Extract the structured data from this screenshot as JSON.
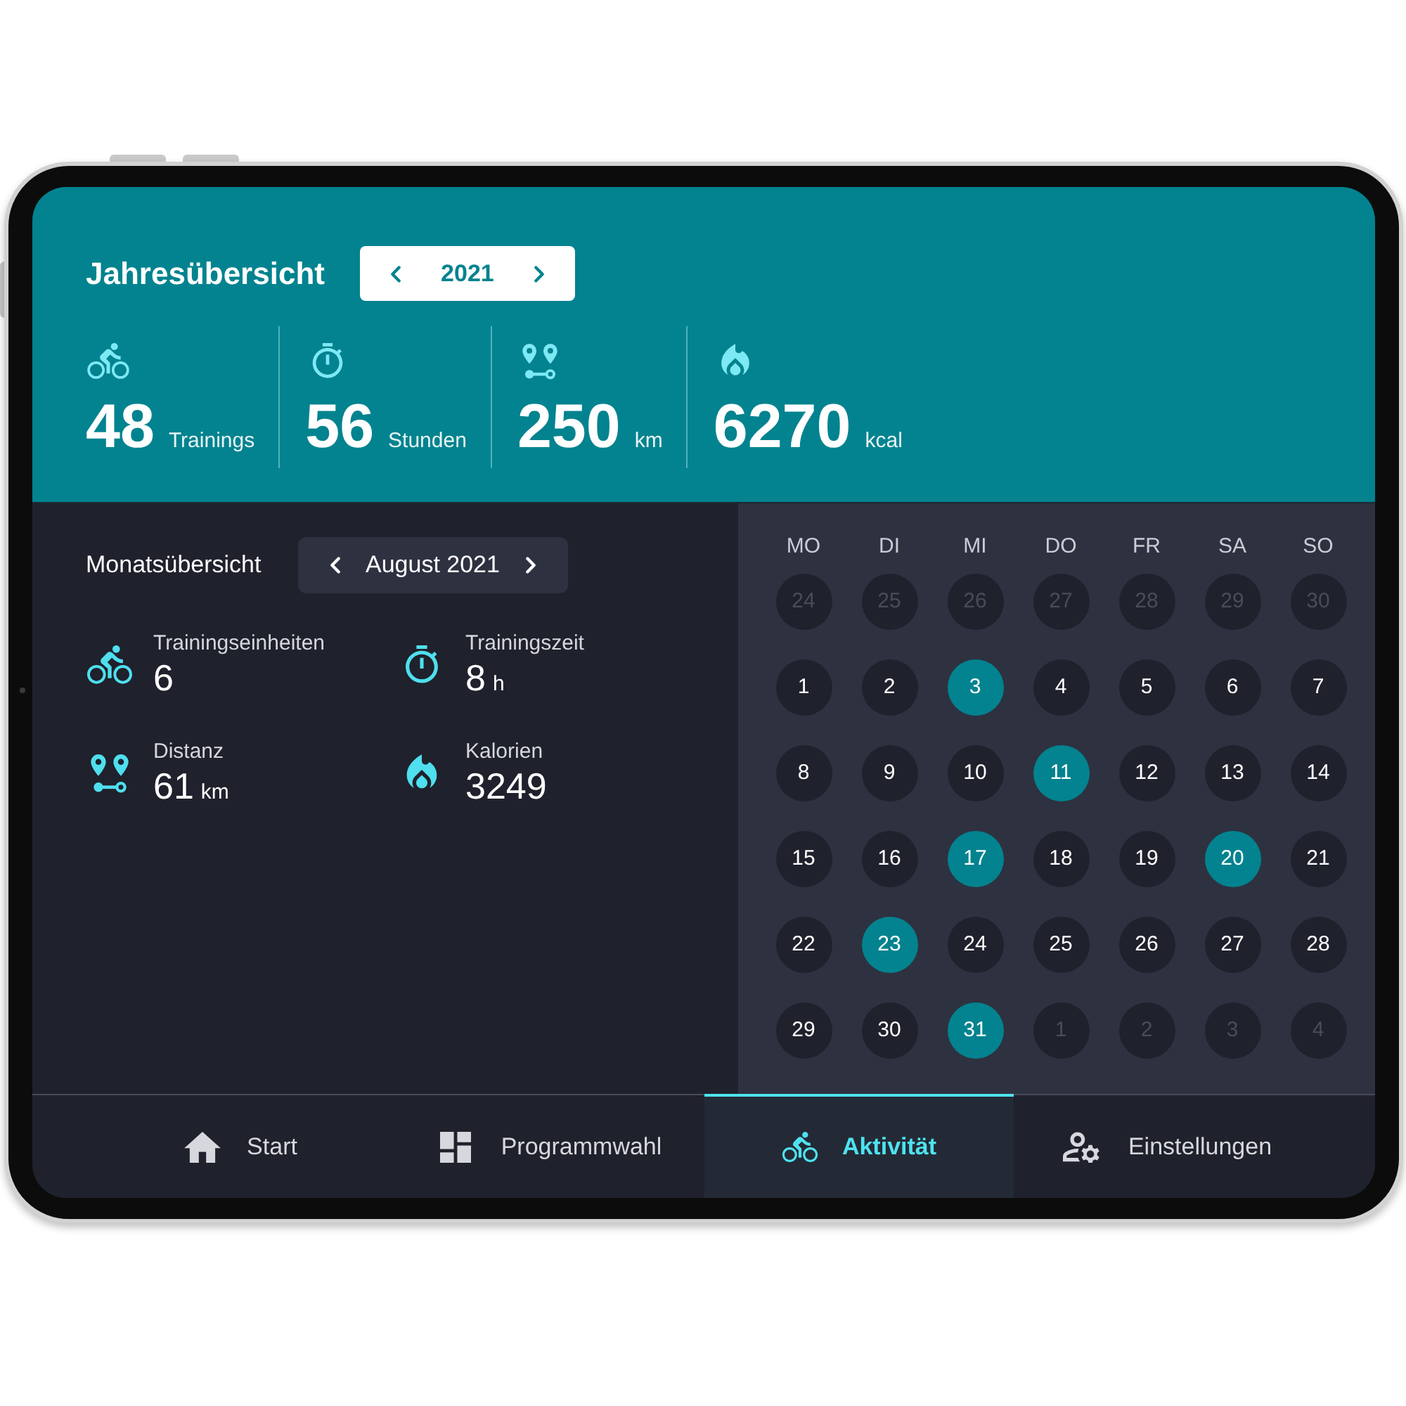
{
  "year_overview": {
    "title": "Jahresübersicht",
    "year": "2021",
    "stats": [
      {
        "kind": "cycling",
        "value": "48",
        "unit": "Trainings"
      },
      {
        "kind": "timer",
        "value": "56",
        "unit": "Stunden"
      },
      {
        "kind": "distance",
        "value": "250",
        "unit": "km"
      },
      {
        "kind": "calories",
        "value": "6270",
        "unit": "kcal"
      }
    ]
  },
  "month_overview": {
    "title": "Monatsübersicht",
    "month": "August 2021",
    "stats": [
      {
        "kind": "cycling",
        "label": "Trainingseinheiten",
        "value": "6"
      },
      {
        "kind": "timer",
        "label": "Trainingszeit",
        "value": "8",
        "unit": "h"
      },
      {
        "kind": "distance",
        "label": "Distanz",
        "value": "61",
        "unit": "km"
      },
      {
        "kind": "calories",
        "label": "Kalorien",
        "value": "3249"
      }
    ]
  },
  "calendar": {
    "weekdays": [
      "MO",
      "DI",
      "MI",
      "DO",
      "FR",
      "SA",
      "SO"
    ],
    "days": [
      {
        "label": "24",
        "in_month": false,
        "selected": false
      },
      {
        "label": "25",
        "in_month": false,
        "selected": false
      },
      {
        "label": "26",
        "in_month": false,
        "selected": false
      },
      {
        "label": "27",
        "in_month": false,
        "selected": false
      },
      {
        "label": "28",
        "in_month": false,
        "selected": false
      },
      {
        "label": "29",
        "in_month": false,
        "selected": false
      },
      {
        "label": "30",
        "in_month": false,
        "selected": false
      },
      {
        "label": "1",
        "in_month": true,
        "selected": false
      },
      {
        "label": "2",
        "in_month": true,
        "selected": false
      },
      {
        "label": "3",
        "in_month": true,
        "selected": true
      },
      {
        "label": "4",
        "in_month": true,
        "selected": false
      },
      {
        "label": "5",
        "in_month": true,
        "selected": false
      },
      {
        "label": "6",
        "in_month": true,
        "selected": false
      },
      {
        "label": "7",
        "in_month": true,
        "selected": false
      },
      {
        "label": "8",
        "in_month": true,
        "selected": false
      },
      {
        "label": "9",
        "in_month": true,
        "selected": false
      },
      {
        "label": "10",
        "in_month": true,
        "selected": false
      },
      {
        "label": "11",
        "in_month": true,
        "selected": true
      },
      {
        "label": "12",
        "in_month": true,
        "selected": false
      },
      {
        "label": "13",
        "in_month": true,
        "selected": false
      },
      {
        "label": "14",
        "in_month": true,
        "selected": false
      },
      {
        "label": "15",
        "in_month": true,
        "selected": false
      },
      {
        "label": "16",
        "in_month": true,
        "selected": false
      },
      {
        "label": "17",
        "in_month": true,
        "selected": true
      },
      {
        "label": "18",
        "in_month": true,
        "selected": false
      },
      {
        "label": "19",
        "in_month": true,
        "selected": false
      },
      {
        "label": "20",
        "in_month": true,
        "selected": true
      },
      {
        "label": "21",
        "in_month": true,
        "selected": false
      },
      {
        "label": "22",
        "in_month": true,
        "selected": false
      },
      {
        "label": "23",
        "in_month": true,
        "selected": true
      },
      {
        "label": "24",
        "in_month": true,
        "selected": false
      },
      {
        "label": "25",
        "in_month": true,
        "selected": false
      },
      {
        "label": "26",
        "in_month": true,
        "selected": false
      },
      {
        "label": "27",
        "in_month": true,
        "selected": false
      },
      {
        "label": "28",
        "in_month": true,
        "selected": false
      },
      {
        "label": "29",
        "in_month": true,
        "selected": false
      },
      {
        "label": "30",
        "in_month": true,
        "selected": false
      },
      {
        "label": "31",
        "in_month": true,
        "selected": true
      },
      {
        "label": "1",
        "in_month": false,
        "selected": false
      },
      {
        "label": "2",
        "in_month": false,
        "selected": false
      },
      {
        "label": "3",
        "in_month": false,
        "selected": false
      },
      {
        "label": "4",
        "in_month": false,
        "selected": false
      }
    ]
  },
  "tab_bar": {
    "tabs": [
      {
        "kind": "home",
        "label": "Start",
        "selected": false
      },
      {
        "kind": "programs",
        "label": "Programmwahl",
        "selected": false
      },
      {
        "kind": "activity",
        "label": "Aktivität",
        "selected": true
      },
      {
        "kind": "settings",
        "label": "Einstellungen",
        "selected": false
      }
    ]
  }
}
